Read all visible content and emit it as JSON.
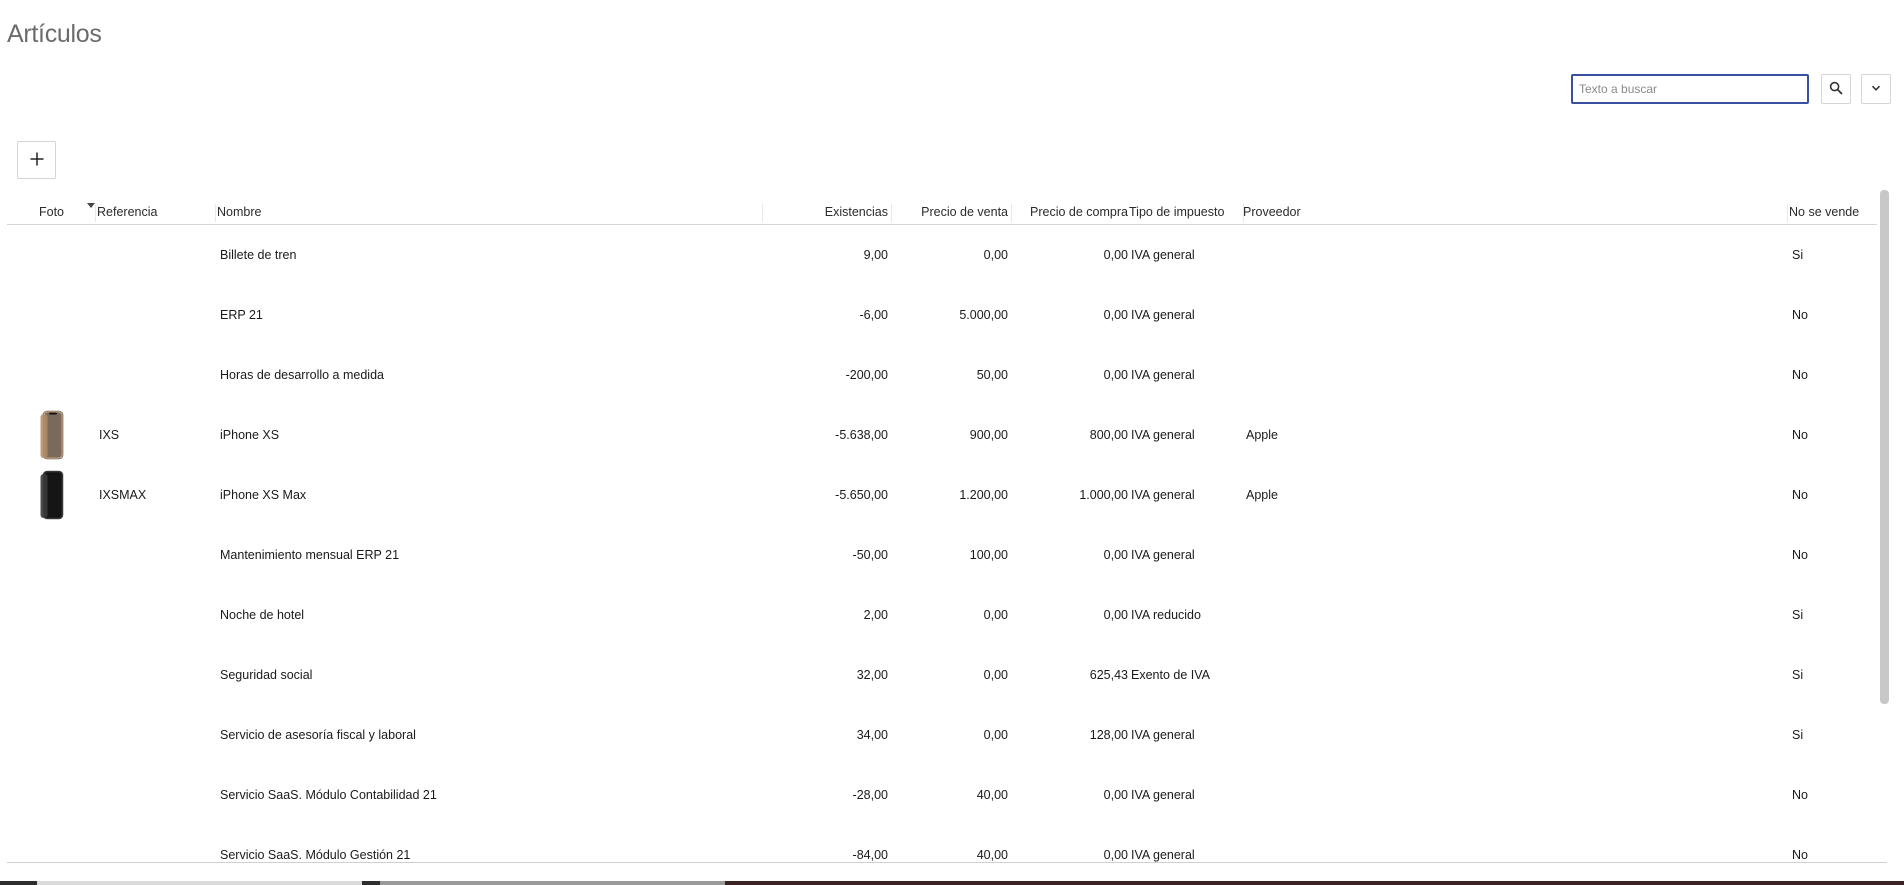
{
  "page": {
    "title": "Artículos"
  },
  "search": {
    "placeholder": "Texto a buscar",
    "search_icon": "search-icon",
    "expand_icon": "chevron-down-icon"
  },
  "toolbar": {
    "add_icon": "plus-icon"
  },
  "table": {
    "columns": {
      "foto": "Foto",
      "referencia": "Referencia",
      "nombre": "Nombre",
      "existencias": "Existencias",
      "precio_venta": "Precio de venta",
      "precio_compra": "Precio de compra",
      "tipo_impuesto": "Tipo de impuesto",
      "proveedor": "Proveedor",
      "no_se_vende": "No se vende"
    },
    "rows": [
      {
        "photo": "",
        "ref": "",
        "name": "Billete de tren",
        "stock": "9,00",
        "sale": "0,00",
        "cost": "0,00",
        "tax": "IVA general",
        "supplier": "",
        "not_sold": "Si"
      },
      {
        "photo": "",
        "ref": "",
        "name": "ERP 21",
        "stock": "-6,00",
        "sale": "5.000,00",
        "cost": "0,00",
        "tax": "IVA general",
        "supplier": "",
        "not_sold": "No"
      },
      {
        "photo": "",
        "ref": "",
        "name": "Horas de desarrollo a medida",
        "stock": "-200,00",
        "sale": "50,00",
        "cost": "0,00",
        "tax": "IVA general",
        "supplier": "",
        "not_sold": "No"
      },
      {
        "photo": "iphone-xs-gold",
        "ref": "IXS",
        "name": "iPhone XS",
        "stock": "-5.638,00",
        "sale": "900,00",
        "cost": "800,00",
        "tax": "IVA general",
        "supplier": "Apple",
        "not_sold": "No"
      },
      {
        "photo": "iphone-xs-max-black",
        "ref": "IXSMAX",
        "name": "iPhone XS Max",
        "stock": "-5.650,00",
        "sale": "1.200,00",
        "cost": "1.000,00",
        "tax": "IVA general",
        "supplier": "Apple",
        "not_sold": "No"
      },
      {
        "photo": "",
        "ref": "",
        "name": "Mantenimiento mensual ERP 21",
        "stock": "-50,00",
        "sale": "100,00",
        "cost": "0,00",
        "tax": "IVA general",
        "supplier": "",
        "not_sold": "No"
      },
      {
        "photo": "",
        "ref": "",
        "name": "Noche de hotel",
        "stock": "2,00",
        "sale": "0,00",
        "cost": "0,00",
        "tax": "IVA reducido",
        "supplier": "",
        "not_sold": "Si"
      },
      {
        "photo": "",
        "ref": "",
        "name": "Seguridad social",
        "stock": "32,00",
        "sale": "0,00",
        "cost": "625,43",
        "tax": "Exento de IVA",
        "supplier": "",
        "not_sold": "Si"
      },
      {
        "photo": "",
        "ref": "",
        "name": "Servicio de asesoría fiscal y laboral",
        "stock": "34,00",
        "sale": "0,00",
        "cost": "128,00",
        "tax": "IVA general",
        "supplier": "",
        "not_sold": "Si"
      },
      {
        "photo": "",
        "ref": "",
        "name": "Servicio SaaS. Módulo Contabilidad 21",
        "stock": "-28,00",
        "sale": "40,00",
        "cost": "0,00",
        "tax": "IVA general",
        "supplier": "",
        "not_sold": "No"
      },
      {
        "photo": "",
        "ref": "",
        "name": "Servicio SaaS. Módulo Gestión 21",
        "stock": "-84,00",
        "sale": "40,00",
        "cost": "0,00",
        "tax": "IVA general",
        "supplier": "",
        "not_sold": "No"
      }
    ]
  },
  "colors": {
    "search_border": "#3a4f9e",
    "title": "#6b6b6b",
    "phone_gold": "#c9a27e",
    "phone_black": "#2b2b2b"
  }
}
